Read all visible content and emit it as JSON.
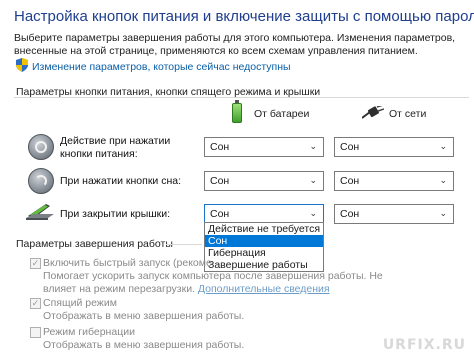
{
  "header": {
    "title": "Настройка кнопок питания и включение защиты с помощью пароля",
    "description": "Выберите параметры завершения работы для этого компьютера. Изменения параметров, внесенные на этой странице, применяются ко всем схемам управления питанием.",
    "change_settings_link": "Изменение параметров, которые сейчас недоступны"
  },
  "power_buttons": {
    "group_title": "Параметры кнопки питания, кнопки спящего режима и крышки",
    "col_battery": "От батареи",
    "col_plugged": "От сети",
    "rows": [
      {
        "label": "Действие при нажатии кнопки питания:",
        "battery": "Сон",
        "plugged": "Сон"
      },
      {
        "label": "При нажатии кнопки сна:",
        "battery": "Сон",
        "plugged": "Сон"
      },
      {
        "label": "При закрытии крышки:",
        "battery": "Сон",
        "plugged": "Сон"
      }
    ],
    "dropdown_options": [
      "Действие не требуется",
      "Сон",
      "Гибернация",
      "Завершение работы"
    ],
    "dropdown_selected_index": 1
  },
  "shutdown": {
    "group_title": "Параметры завершения работы",
    "fast_startup": {
      "label": "Включить быстрый запуск (рекоме",
      "checked": true,
      "desc": "Помогает ускорить запуск компьютера после завершения работы. Не влияет на режим перезагрузки.",
      "more_link": "Дополнительные сведения"
    },
    "sleep": {
      "label": "Спящий режим",
      "checked": true,
      "desc": "Отображать в меню завершения работы."
    },
    "hibernate": {
      "label": "Режим гибернации",
      "checked": false,
      "desc": "Отображать в меню завершения работы."
    }
  },
  "watermark": "URFIX.RU",
  "colors": {
    "accent": "#0078d7",
    "title": "#1f3e8f",
    "link": "#0a5fa8"
  }
}
